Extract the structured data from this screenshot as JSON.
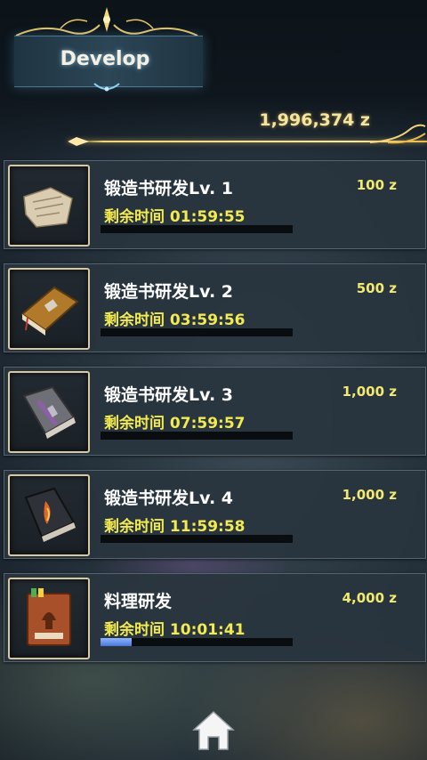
{
  "header": {
    "title": "Develop"
  },
  "wallet": {
    "amount": "1,996,374 z"
  },
  "remaining_label": "剩余时间",
  "items": [
    {
      "name": "锻造书研发Lv. 1",
      "cost": "100 z",
      "time": "01:59:55",
      "progress": 0,
      "icon": "torn-paper-scroll-icon"
    },
    {
      "name": "锻造书研发Lv. 2",
      "cost": "500 z",
      "time": "03:59:56",
      "progress": 0,
      "icon": "brown-book-icon"
    },
    {
      "name": "锻造书研发Lv. 3",
      "cost": "1,000 z",
      "time": "07:59:57",
      "progress": 0,
      "icon": "grey-sword-book-icon"
    },
    {
      "name": "锻造书研发Lv. 4",
      "cost": "1,000 z",
      "time": "11:59:58",
      "progress": 0,
      "icon": "dark-fire-book-icon"
    },
    {
      "name": "料理研发",
      "cost": "4,000 z",
      "time": "10:01:41",
      "progress": 0.16,
      "icon": "cooking-book-icon"
    }
  ],
  "footer": {
    "icon": "home-icon"
  },
  "colors": {
    "gold": "#f2ea50",
    "accent_blue": "#4a78d8"
  }
}
